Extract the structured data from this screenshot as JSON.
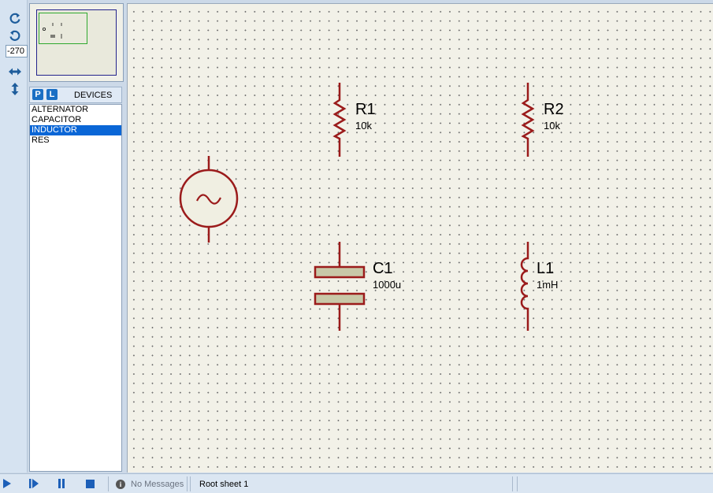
{
  "toolbar": {
    "rotate_cw_icon": "rotate-clockwise",
    "rotate_ccw_icon": "rotate-anticlockwise",
    "rotation_value": "-270",
    "flip_h_icon": "flip-horizontal",
    "flip_v_icon": "flip-vertical"
  },
  "devices_panel": {
    "p_label": "P",
    "l_label": "L",
    "title": "DEVICES",
    "items": [
      {
        "label": "ALTERNATOR",
        "selected": false
      },
      {
        "label": "CAPACITOR",
        "selected": false
      },
      {
        "label": "INDUCTOR",
        "selected": true
      },
      {
        "label": "RES",
        "selected": false
      }
    ]
  },
  "schematic": {
    "wire_color": "#9b1b1b",
    "body_fill": "#c8c8a8",
    "components": {
      "r1": {
        "ref": "R1",
        "value": "10k"
      },
      "r2": {
        "ref": "R2",
        "value": "10k"
      },
      "c1": {
        "ref": "C1",
        "value": "1000u"
      },
      "l1": {
        "ref": "L1",
        "value": "1mH"
      }
    }
  },
  "statusbar": {
    "messages": "No Messages",
    "info_icon": "i",
    "sheet": "Root sheet 1"
  }
}
